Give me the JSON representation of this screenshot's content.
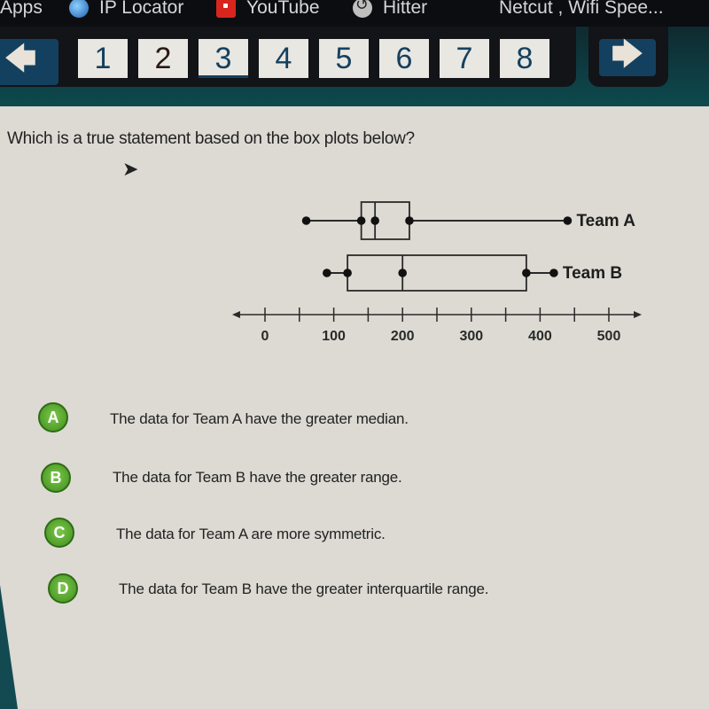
{
  "bookmarks_bar": {
    "items": [
      {
        "label": "Apps",
        "icon": "apps-icon"
      },
      {
        "label": "IP Locator",
        "icon": "globe-icon"
      },
      {
        "label": "YouTube",
        "icon": "youtube-icon"
      },
      {
        "label": "Hitter",
        "icon": "hitter-icon"
      },
      {
        "label": "Netcut , Wifi Spee...",
        "icon": "none"
      }
    ]
  },
  "navigation": {
    "prev_label": "🡄",
    "next_label": "🡆",
    "pages": [
      "1",
      "2",
      "3",
      "4",
      "5",
      "6",
      "7",
      "8"
    ],
    "current_page": "3"
  },
  "question": {
    "text": "Which is a true statement based on the box plots below?"
  },
  "chart_data": {
    "type": "boxplot",
    "title": "",
    "xlabel": "",
    "ylabel": "",
    "x_range": [
      -40,
      540
    ],
    "ticks": [
      0,
      50,
      100,
      150,
      200,
      250,
      300,
      350,
      400,
      450,
      500
    ],
    "tick_labels": [
      "0",
      "100",
      "200",
      "300",
      "400",
      "500"
    ],
    "labeled_ticks": [
      0,
      100,
      200,
      300,
      400,
      500
    ],
    "series": [
      {
        "name": "Team A",
        "min": 60,
        "q1": 140,
        "median": 160,
        "q3": 210,
        "max": 440
      },
      {
        "name": "Team B",
        "min": 90,
        "q1": 120,
        "median": 200,
        "q3": 380,
        "max": 420
      }
    ],
    "legend": "labels right of each plot"
  },
  "options": [
    {
      "letter": "A",
      "text": "The data for Team A have the greater median."
    },
    {
      "letter": "B",
      "text": "The data for Team B have the greater range."
    },
    {
      "letter": "C",
      "text": "The data for Team A are more symmetric."
    },
    {
      "letter": "D",
      "text": "The data for Team B have the greater interquartile range."
    }
  ],
  "colors": {
    "badge_green": "#5aa832",
    "nav_blue": "#14405f",
    "teal_band": "#0d4a4e",
    "content_bg": "#dcdad3"
  }
}
